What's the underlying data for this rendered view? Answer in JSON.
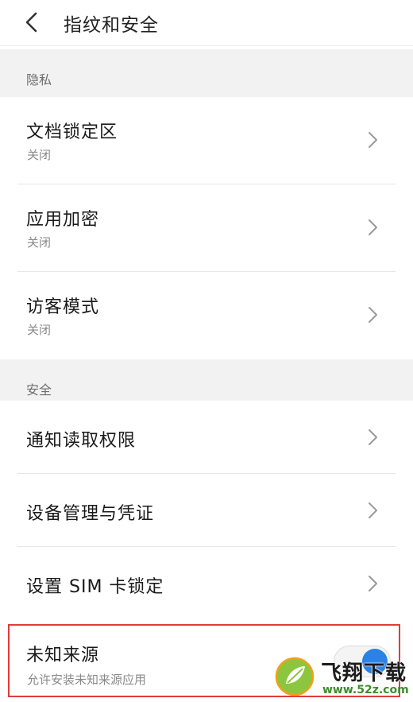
{
  "header": {
    "back_icon": "back-arrow-icon",
    "title": "指纹和安全"
  },
  "sections": {
    "privacy": {
      "label": "隐私",
      "items": [
        {
          "title": "文档锁定区",
          "subtitle": "关闭"
        },
        {
          "title": "应用加密",
          "subtitle": "关闭"
        },
        {
          "title": "访客模式",
          "subtitle": "关闭"
        }
      ]
    },
    "security": {
      "label": "安全",
      "items": [
        {
          "title": "通知读取权限"
        },
        {
          "title": "设备管理与凭证"
        },
        {
          "title": "设置 SIM 卡锁定"
        },
        {
          "title": "未知来源",
          "subtitle": "允许安装未知来源应用",
          "toggle_on": true
        }
      ]
    }
  },
  "watermark": {
    "brand": "飞翔下载",
    "site": "www.52z.com"
  },
  "colors": {
    "accent": "#2a82e4",
    "highlight": "#e23b3b",
    "section_bg": "#f2f2f2"
  }
}
